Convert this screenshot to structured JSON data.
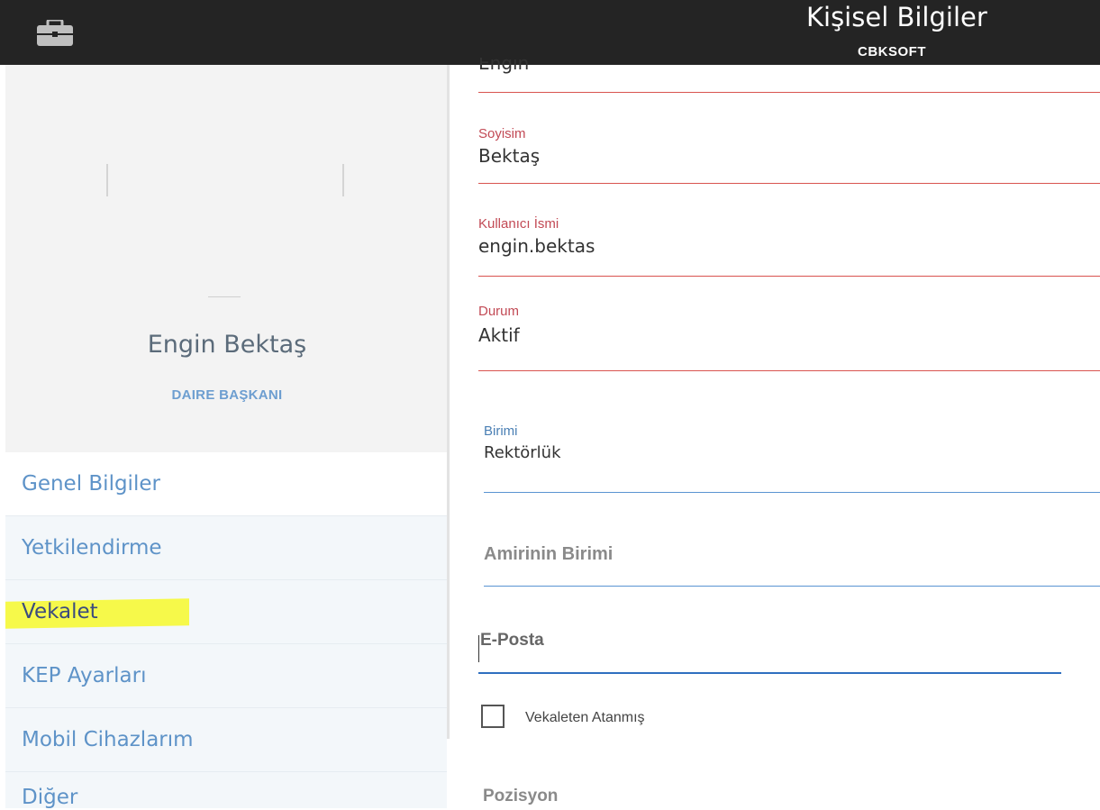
{
  "header": {
    "title": "Kişisel Bilgiler",
    "subtitle": "CBKSOFT",
    "icon": "briefcase-icon"
  },
  "profile": {
    "name": "Engin Bektaş",
    "role": "DAIRE BAŞKANI"
  },
  "nav": {
    "items": [
      {
        "label": "Genel Bilgiler"
      },
      {
        "label": "Yetkilendirme"
      },
      {
        "label": "Vekalet"
      },
      {
        "label": "KEP Ayarları"
      },
      {
        "label": "Mobil Cihazlarım"
      },
      {
        "label": "Diğer"
      }
    ]
  },
  "form": {
    "first_name_value": "Engin",
    "surname_label": "Soyisim",
    "surname_value": "Bektaş",
    "username_label": "Kullanıcı İsmi",
    "username_value": "engin.bektas",
    "status_label": "Durum",
    "status_value": "Aktif",
    "unit_label": "Birimi",
    "unit_value": "Rektörlük",
    "manager_unit_placeholder": "Amirinin Birimi",
    "email_placeholder": "E-Posta",
    "proxy_checkbox_label": "Vekaleten Atanmış",
    "position_placeholder": "Pozisyon"
  },
  "colors": {
    "topbar": "#242424",
    "error_red": "#d9534f",
    "accent_blue": "#5a94d2",
    "highlight_yellow": "#f6f94a"
  }
}
